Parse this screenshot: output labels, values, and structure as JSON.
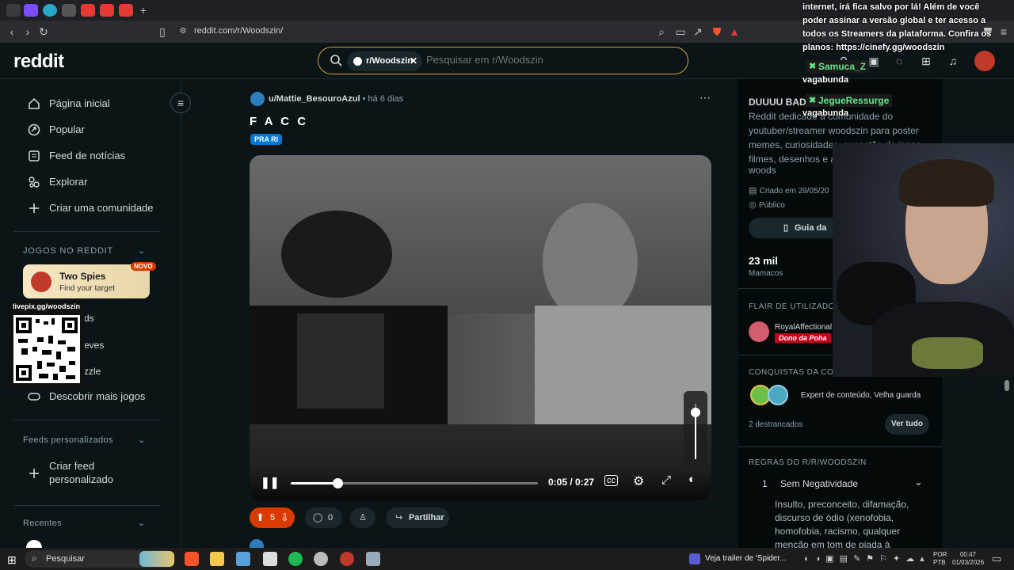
{
  "browser": {
    "url": "reddit.com/r/Woodszin/"
  },
  "header": {
    "logo": "reddit",
    "community_chip": "r/Woodszin",
    "search_placeholder": "Pesquisar em r/Woodszin"
  },
  "sidebar": {
    "items": [
      {
        "label": "Página inicial",
        "icon": "home-icon"
      },
      {
        "label": "Popular",
        "icon": "popular-icon"
      },
      {
        "label": "Feed de notícias",
        "icon": "news-icon"
      },
      {
        "label": "Explorar",
        "icon": "explore-icon"
      },
      {
        "label": "Criar uma comunidade",
        "icon": "plus-icon"
      }
    ],
    "games_title": "JOGOS NO REDDIT",
    "featured_game": {
      "name": "Two Spies",
      "tagline": "Find your target",
      "badge": "NOVO"
    },
    "games_partial": [
      "ds",
      "eves",
      "zzle"
    ],
    "discover_games": "Descobrir mais jogos",
    "custom_feeds_title": "Feeds personalizados",
    "create_feed": "Criar feed personalizado",
    "recents_title": "Recentes",
    "qr_label": "livepix.gg/woodszin"
  },
  "post": {
    "author": "u/Mattie_BesouroAzul",
    "time": "há 6 dias",
    "title": "F A C C",
    "flair": "PRA RI",
    "video": {
      "current_time": "0:05",
      "duration": "0:27",
      "progress": 0.19,
      "volume": 0.85
    },
    "votes": "5",
    "comments": "0",
    "share_label": "Partilhar"
  },
  "rightbar": {
    "title": "DUUUU BADO",
    "description": "Reddit dedicado à comunidade do youtuber/streamer woodszin para poster memes, curiosidades, sugestão de jogos, filmes, desenhos e as",
    "desc_last": "woods",
    "created": "Criado em 29/05/20",
    "visibility": "Público",
    "guide_btn": "Guia da",
    "members_count": "23 mil",
    "members_label": "Mamacos",
    "flair_title": "FLAIR DE UTILIZADOR",
    "flair_user": "RoyalAffectional",
    "flair_tag": "Dono da Poha",
    "achievements_title": "CONQUISTAS DA COMU",
    "achievements": "Expert de conteúdo, Velha guarda",
    "unlocked": "2 destrancados",
    "see_all": "Ver tudo",
    "rules_title": "REGRAS DO R/R/WOODSZIN",
    "rule_num": "1",
    "rule_title": "Sem Negatividade",
    "rule_body": [
      "Insulto, preconceito, difamação,",
      "discurso de ódio (xenofobia,",
      "homofobia, racismo, qualquer",
      "menção em tom de piada à"
    ]
  },
  "chat": {
    "message_lines": [
      "internet, irá fica salvo por lá! Além de você",
      "poder assinar a versão global e ter acesso a",
      "todos os Streamers da plataforma. Confira os",
      "planos: https://cinefy.gg/woodszin"
    ],
    "user1": "Samuca_Z",
    "msg1": "vagabunda",
    "user2": "JegueRessurge",
    "msg2": "vagabunda"
  },
  "taskbar": {
    "search": "Pesquisar",
    "media": "Veja trailer de 'Spider...",
    "lang1": "POR",
    "lang2": "PTB",
    "time": "00:47",
    "date": "01/03/2026"
  },
  "colors": {
    "accent": "#d4a33a",
    "upvote": "#d93a00",
    "flair": "#0079d3",
    "chat_name": "#5fe88a"
  }
}
